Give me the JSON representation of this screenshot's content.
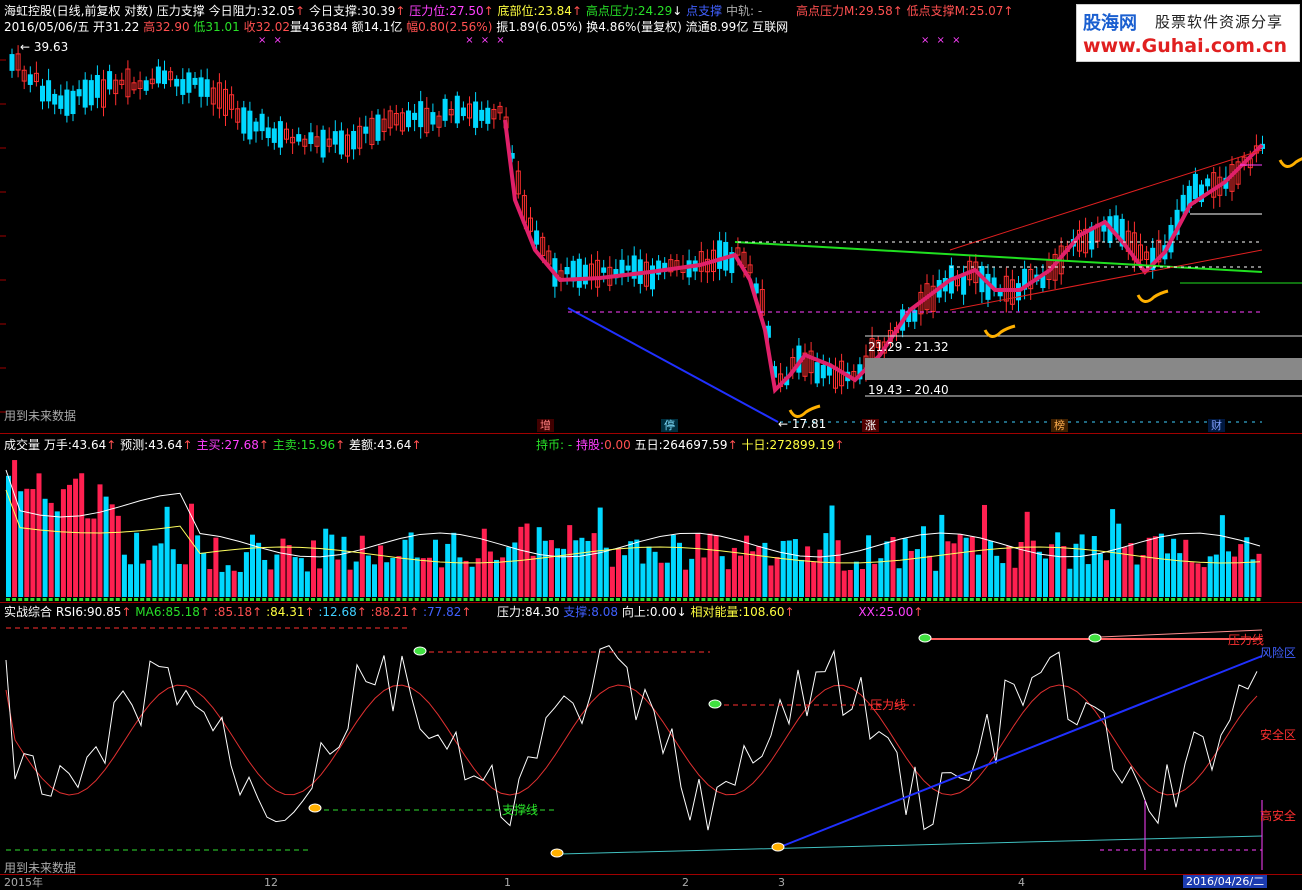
{
  "main_header": {
    "title": "海虹控股(日线,前复权 对数) 压力支撑",
    "resist_label": "今日阻力:",
    "resist_value": "32.05",
    "support_label": "今日支撑:",
    "support_value": "30.39",
    "press_label": "压力位:",
    "press_value": "27.50",
    "bottom_label": "底部位:",
    "bottom_value": "23.84",
    "highpress_label": "高点压力:",
    "highpress_value": "24.29",
    "lowsupp_label": "点支撑",
    "mid_label": "中轨: -",
    "hp_m_label": "高点压力M:",
    "hp_m_value": "29.58",
    "ls_m_label": "低点支撑M:",
    "ls_m_value": "25.07"
  },
  "quote_line": {
    "date": "2016/05/06/五",
    "open": "开31.22",
    "high": "高32.90",
    "low": "低31.01",
    "close": "收32.02",
    "vol": "量436384",
    "amt": "额14.1亿",
    "chg": "幅0.80(2.56%)",
    "amp": "振1.89(6.05%)",
    "turn": "换4.86%(量复权)",
    "float": "流通8.99亿",
    "site": "互联网"
  },
  "price_labels": {
    "top_price": "39.63",
    "range1": "21.29 - 21.32",
    "range2": "19.43 - 20.40",
    "low_price": "17.81",
    "future_note": "用到未来数据"
  },
  "event_badges": [
    "增",
    "停",
    "涨",
    "榜",
    "财"
  ],
  "volume_header": {
    "title": "成交量",
    "wanshou_label": "万手:",
    "wanshou_value": "43.64",
    "yuce_label": "预测:",
    "yuce_value": "43.64",
    "zhumai_label": "主买:",
    "zhumai_value": "27.68",
    "zhumai2_label": "主卖:",
    "zhumai2_value": "15.96",
    "diff_label": "差额:",
    "diff_value": "43.64",
    "hold_label": "持币: -",
    "hold_label2": "持股:",
    "hold_value": "0.00",
    "five_label": "五日:",
    "five_value": "264697.59",
    "ten_label": "十日:",
    "ten_value": "272899.19"
  },
  "indicator_header": {
    "title": "实战综合",
    "rsi_label": "RSI6:",
    "rsi_value": "90.85",
    "ma_label": "MA6:",
    "ma_value": "85.18",
    "v1": ":85.18",
    "v2": ":84.31",
    "v3": ":12.68",
    "v4": ":88.21",
    "v5": ":77.82",
    "press_label": "压力:",
    "press_value": "84.30",
    "supp_label": "支撑:",
    "supp_value": "8.08",
    "up_label": "向上:",
    "up_value": "0.00",
    "energy_label": "相对能量:",
    "energy_value": "108.60",
    "xx_label": "XX:",
    "xx_value": "25.00"
  },
  "indicator_labels": {
    "press_line": "压力线",
    "press_line2": "压力线",
    "support_line": "支撑线",
    "risk": "风险区",
    "safe": "安全区",
    "high_safe": "高安全",
    "future_note": "用到未来数据"
  },
  "time_axis": [
    "2015年",
    "12",
    "1",
    "2",
    "3",
    "4"
  ],
  "axis_date_badge": "2016/04/26/二",
  "logo": {
    "brand": "股海网",
    "tagline": "股票软件资源分享",
    "url": "www.Guhai.com.cn"
  },
  "colors": {
    "up": "#ff3030",
    "down": "#00d8ff",
    "ma_pink": "#e0206a",
    "bg": "#000000"
  }
}
